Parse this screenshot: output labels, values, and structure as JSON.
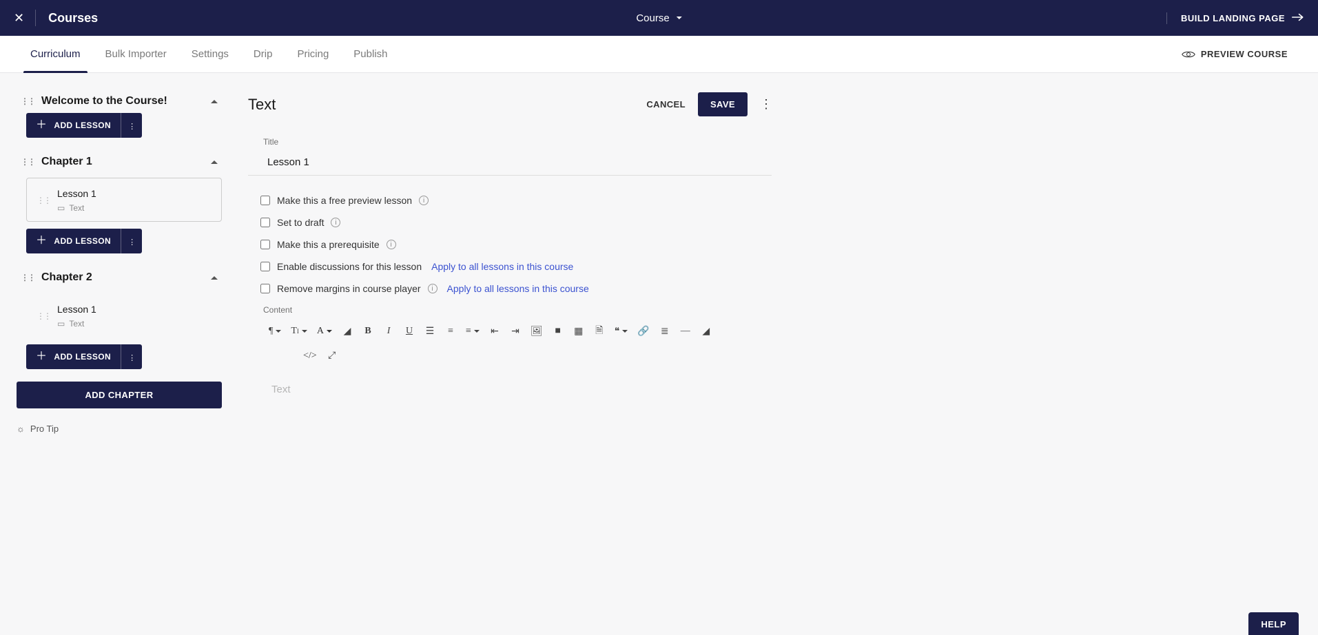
{
  "topbar": {
    "app_title": "Courses",
    "center_select": "Course",
    "build_landing": "BUILD LANDING PAGE"
  },
  "tabs": {
    "items": [
      "Curriculum",
      "Bulk Importer",
      "Settings",
      "Drip",
      "Pricing",
      "Publish"
    ],
    "active_index": 0,
    "preview": "PREVIEW COURSE"
  },
  "sidebar": {
    "chapters": [
      {
        "title": "Welcome to the Course!",
        "lessons": []
      },
      {
        "title": "Chapter 1",
        "lessons": [
          {
            "title": "Lesson 1",
            "type": "Text",
            "selected": true
          }
        ]
      },
      {
        "title": "Chapter 2",
        "lessons": [
          {
            "title": "Lesson 1",
            "type": "Text",
            "selected": false
          }
        ]
      }
    ],
    "add_lesson_label": "ADD LESSON",
    "add_chapter_label": "ADD CHAPTER",
    "protip_label": "Pro Tip"
  },
  "editor": {
    "heading": "Text",
    "cancel": "CANCEL",
    "save": "SAVE",
    "title_label": "Title",
    "title_value": "Lesson 1",
    "options": {
      "free_preview": "Make this a free preview lesson",
      "set_draft": "Set to draft",
      "prerequisite": "Make this a prerequisite",
      "discussions": "Enable discussions for this lesson",
      "remove_margins": "Remove margins in course player",
      "apply_all": "Apply to all lessons in this course"
    },
    "content_label": "Content",
    "placeholder": "Text"
  },
  "help": "HELP"
}
